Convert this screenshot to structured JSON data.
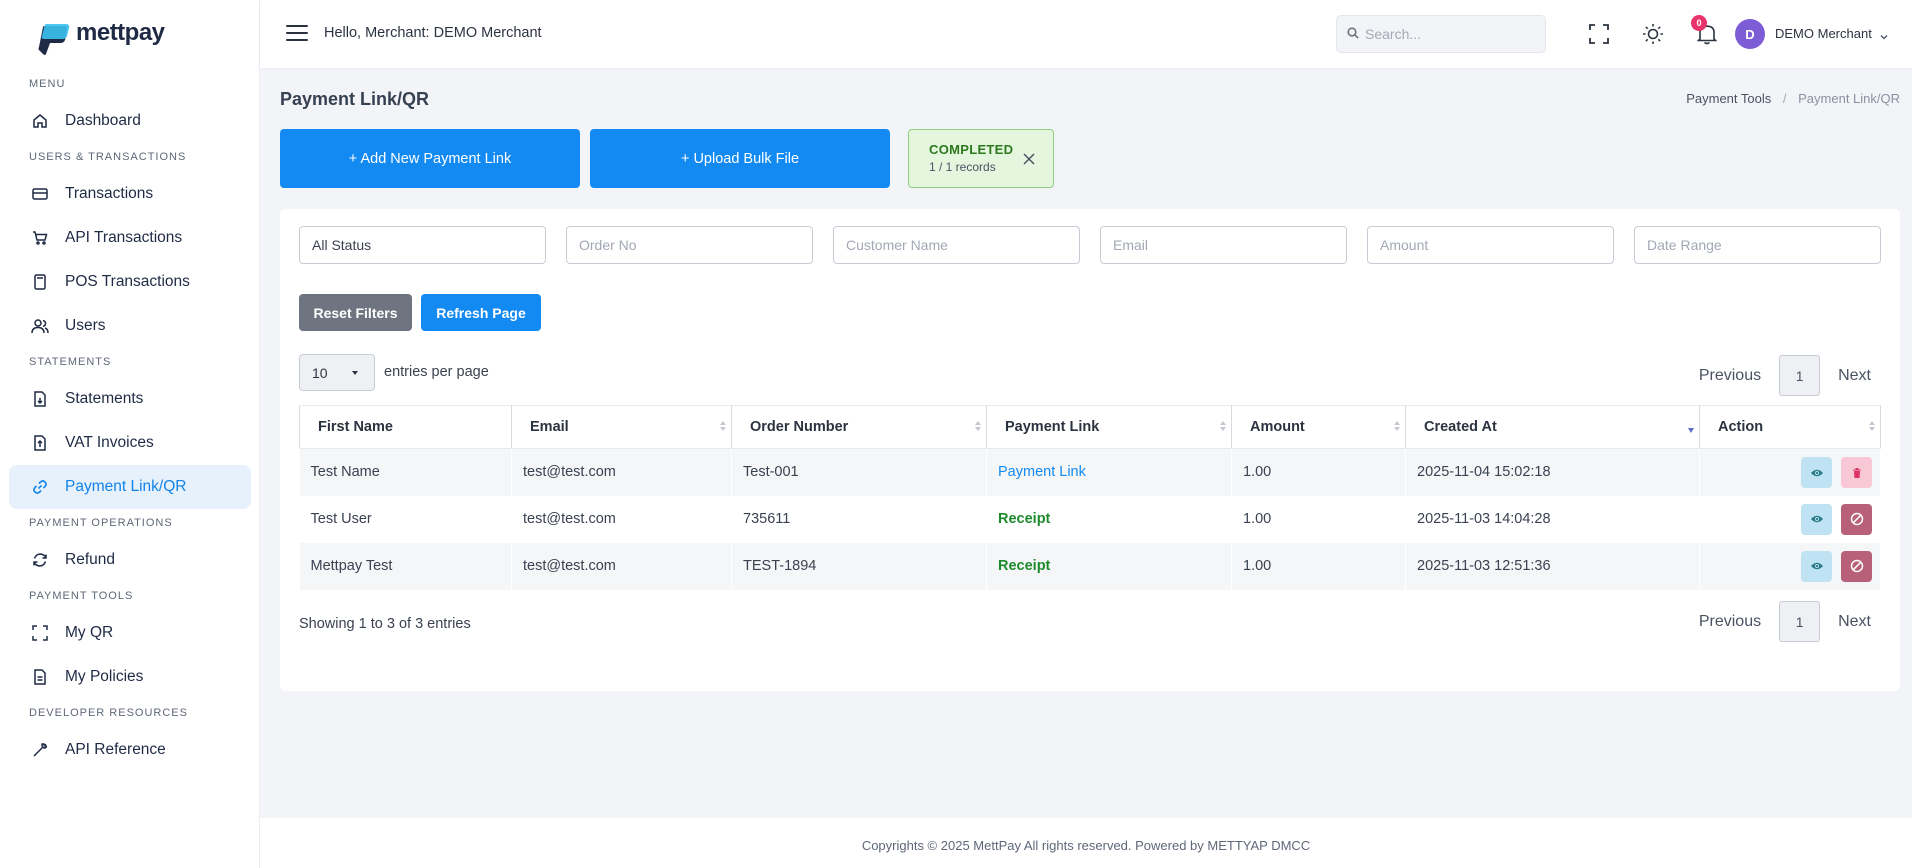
{
  "brand": {
    "name": "mettpay"
  },
  "sidebar": {
    "sections": [
      {
        "title": "MENU",
        "items": [
          {
            "label": "Dashboard",
            "icon": "home-icon"
          }
        ]
      },
      {
        "title": "USERS & TRANSACTIONS",
        "items": [
          {
            "label": "Transactions",
            "icon": "credit-card-icon"
          },
          {
            "label": "API Transactions",
            "icon": "cart-icon"
          },
          {
            "label": "POS Transactions",
            "icon": "pos-terminal-icon"
          },
          {
            "label": "Users",
            "icon": "users-icon"
          }
        ]
      },
      {
        "title": "STATEMENTS",
        "items": [
          {
            "label": "Statements",
            "icon": "statement-doc-icon"
          },
          {
            "label": "VAT Invoices",
            "icon": "invoice-doc-icon"
          },
          {
            "label": "Payment Link/QR",
            "icon": "link-icon",
            "active": true
          }
        ]
      },
      {
        "title": "PAYMENT OPERATIONS",
        "items": [
          {
            "label": "Refund",
            "icon": "refresh-icon"
          }
        ]
      },
      {
        "title": "PAYMENT TOOLS",
        "items": [
          {
            "label": "My QR",
            "icon": "qr-scan-icon"
          },
          {
            "label": "My Policies",
            "icon": "document-icon"
          }
        ]
      },
      {
        "title": "DEVELOPER RESOURCES",
        "items": [
          {
            "label": "API Reference",
            "icon": "wrench-icon"
          }
        ]
      }
    ]
  },
  "topbar": {
    "greeting": "Hello, Merchant: DEMO Merchant",
    "search_placeholder": "Search...",
    "notification_count": "0",
    "avatar_initial": "D",
    "user_name": "DEMO Merchant"
  },
  "page": {
    "title": "Payment Link/QR",
    "breadcrumb": [
      "Payment Tools",
      "Payment Link/QR"
    ],
    "add_button": "+ Add New Payment Link",
    "upload_button": "+ Upload Bulk File",
    "toast": {
      "title": "COMPLETED",
      "subtitle": "1 / 1 records"
    }
  },
  "filters": {
    "status_value": "All Status",
    "order_no_placeholder": "Order No",
    "customer_name_placeholder": "Customer Name",
    "email_placeholder": "Email",
    "amount_placeholder": "Amount",
    "date_range_placeholder": "Date Range",
    "reset_label": "Reset Filters",
    "refresh_label": "Refresh Page"
  },
  "table": {
    "page_length": "10",
    "entries_label": "entries per page",
    "pager": {
      "prev": "Previous",
      "current": "1",
      "next": "Next"
    },
    "columns": [
      "First Name",
      "Email",
      "Order Number",
      "Payment Link",
      "Amount",
      "Created At",
      "Action"
    ],
    "sorted_column": "Created At",
    "rows": [
      {
        "first_name": "Test Name",
        "email": "test@test.com",
        "order_number": "Test-001",
        "payment_link": "Payment Link",
        "link_type": "link",
        "amount": "1.00",
        "created_at": "2025-11-04 15:02:18",
        "actions": [
          "view",
          "delete"
        ]
      },
      {
        "first_name": "Test User",
        "email": "test@test.com",
        "order_number": "735611",
        "payment_link": "Receipt",
        "link_type": "receipt",
        "amount": "1.00",
        "created_at": "2025-11-03 14:04:28",
        "actions": [
          "view",
          "disable"
        ]
      },
      {
        "first_name": "Mettpay Test",
        "email": "test@test.com",
        "order_number": "TEST-1894",
        "payment_link": "Receipt",
        "link_type": "receipt",
        "amount": "1.00",
        "created_at": "2025-11-03 12:51:36",
        "actions": [
          "view",
          "disable"
        ]
      }
    ],
    "showing": "Showing 1 to 3 of 3 entries"
  },
  "footer": {
    "text": "Copyrights © 2025 MettPay All rights reserved. Powered by METTYAP DMCC"
  },
  "colors": {
    "primary": "#138af2",
    "success": "#1d8b2b",
    "badge": "#e8336c",
    "avatar": "#7c5dd6"
  }
}
